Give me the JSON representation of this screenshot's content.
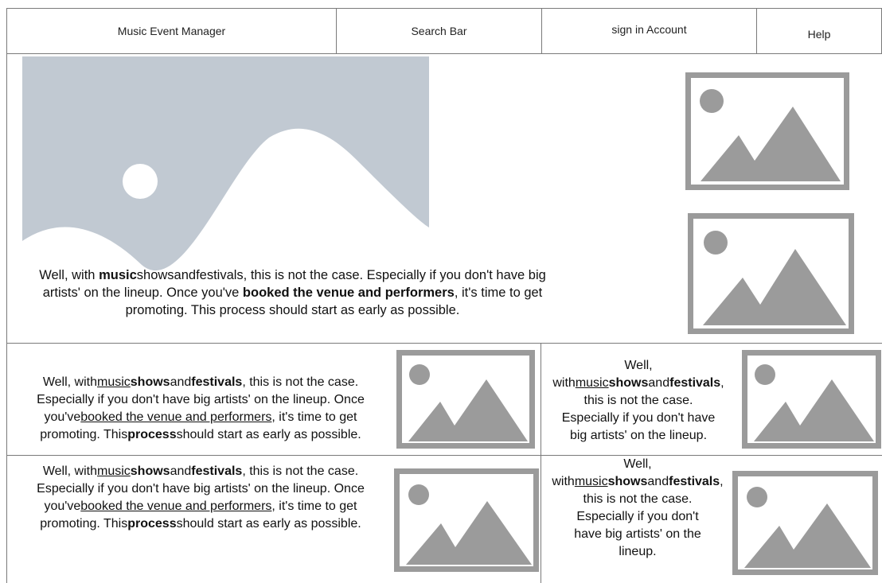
{
  "nav": {
    "app_title": "Music Event Manager",
    "search": "Search Bar",
    "sign_in": "sign in Account",
    "help": "Help"
  },
  "icons": {
    "hero_image": "image-placeholder-icon",
    "image_placeholder": "image-placeholder-icon"
  },
  "colors": {
    "hero_bg": "#c1c9d2",
    "placeholder_gray": "#9b9b9b",
    "border": "#7a7a7a"
  },
  "hero": {
    "p1": "Well, with ",
    "b1": "music",
    "p2": "showsandfestivals, this is not the case. Espec",
    "p3": "ially if you don't have big",
    "p4": "artists' on the lineup. Once you've ",
    "b2": "booked the venue and performers",
    "p5": ", it's time to get",
    "p6": "promoting. This process should start as early as possible."
  },
  "card_long": {
    "t1": "Well, with",
    "u1": "music",
    "b1": "shows",
    "t2": "and",
    "b2": "festivals",
    "t3": ", this is not the case.",
    "t4": "Especially if you don't have big artists' on the lineup. Once",
    "t5": "you've",
    "u2": "booked the venue and performers",
    "t6": ", it's time to get",
    "t7": "promoting. This",
    "b3": "process",
    "t8": "should start as early as possible."
  },
  "card_short": {
    "t1": "Well,",
    "t2": "with",
    "u1": "music",
    "b1": "shows",
    "t3": "and",
    "b2": "festivals",
    "t4": ",",
    "t5": "this is not the case.",
    "t6": "Especially if you don't have",
    "t7": "big artists' on the lineup."
  },
  "card_short2": {
    "t1": "Well,",
    "t2": "with",
    "u1": "music",
    "b1": "shows",
    "t3": "and",
    "b2": "festivals",
    "t4": ",",
    "t5": "this is not the case.",
    "t6": "Especially if you don't",
    "t7": "have big artists' on the",
    "t8": "lineup."
  }
}
